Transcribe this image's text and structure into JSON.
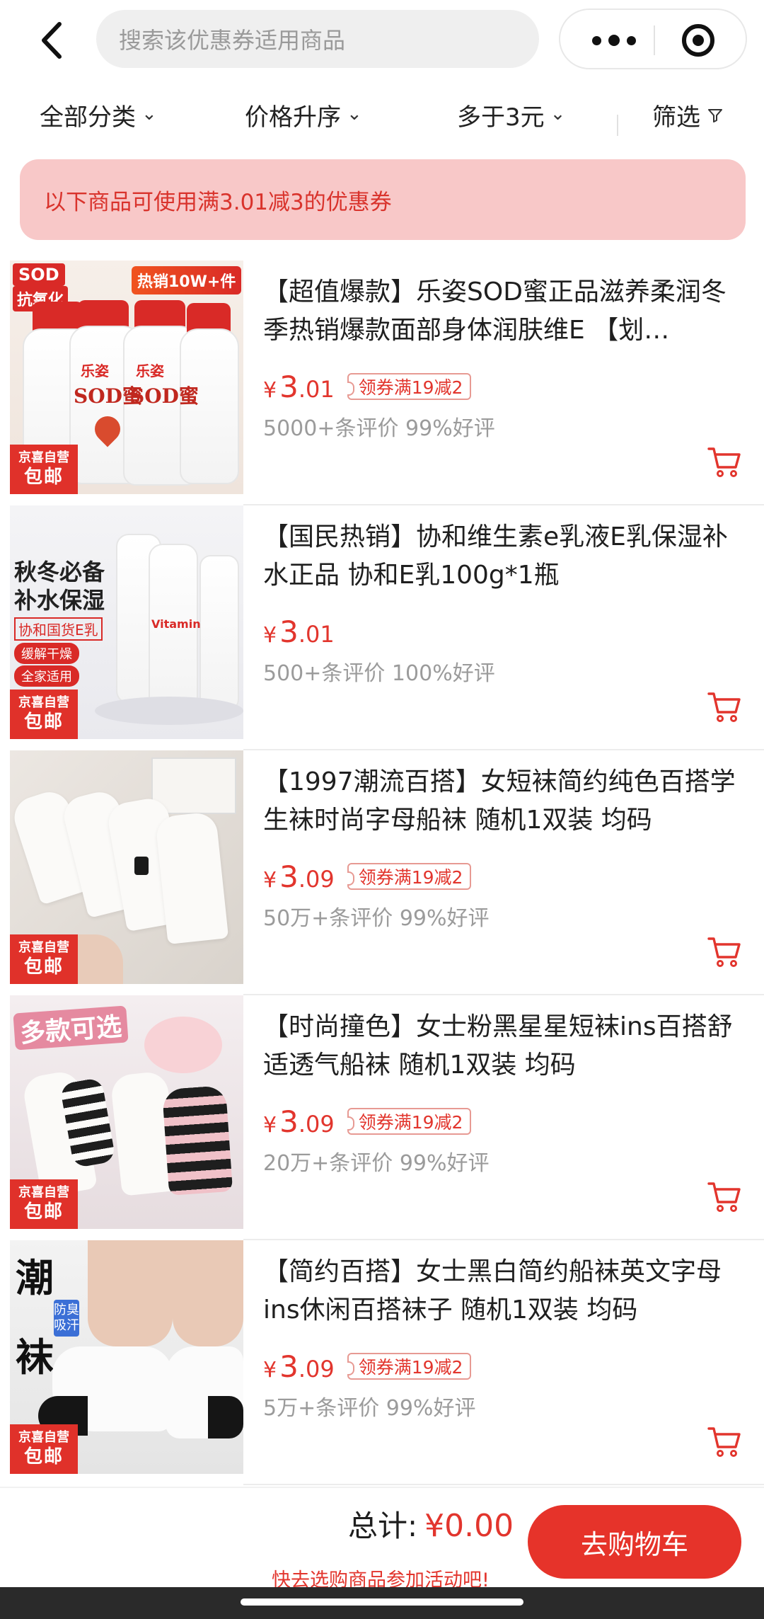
{
  "header": {
    "search_placeholder": "搜索该优惠券适用商品"
  },
  "filters": {
    "category": "全部分类",
    "sort": "价格升序",
    "min_price": "多于3元",
    "filter": "筛选"
  },
  "banner": "以下商品可使用满3.01减3的优惠券",
  "products": [
    {
      "title": "【超值爆款】乐姿SOD蜜正品滋养柔润冬季热销爆款面部身体润肤维E 【划…",
      "currency": "¥",
      "price_int": "3",
      "price_dec": ".01",
      "coupon": "领券满19减2",
      "reviews": "5000+条评价 99%好评",
      "thumb": {
        "tag1": "SOD",
        "tag2": "抗氧化",
        "tag3": "热销10W+件",
        "brand": "乐姿",
        "label": "SOD蜜",
        "jd": "京喜自营",
        "free": "包邮"
      }
    },
    {
      "title": "【国民热销】协和维生素e乳液E乳保湿补水正品 协和E乳100g*1瓶",
      "currency": "¥",
      "price_int": "3",
      "price_dec": ".01",
      "coupon": "",
      "reviews": "500+条评价 100%好评",
      "thumb": {
        "line1": "秋冬必备",
        "line2": "补水保湿",
        "line3": "协和国货E乳",
        "pill1": "缓解干燥",
        "pill2": "全家适用",
        "label": "Vitamin",
        "jd": "京喜自营",
        "free": "包邮"
      }
    },
    {
      "title": "【1997潮流百搭】女短袜简约纯色百搭学生袜时尚字母船袜 随机1双装 均码",
      "currency": "¥",
      "price_int": "3",
      "price_dec": ".09",
      "coupon": "领券满19减2",
      "reviews": "50万+条评价 99%好评",
      "thumb": {
        "jd": "京喜自营",
        "free": "包邮"
      }
    },
    {
      "title": "【时尚撞色】女士粉黑星星短袜ins百搭舒适透气船袜 随机1双装 均码",
      "currency": "¥",
      "price_int": "3",
      "price_dec": ".09",
      "coupon": "领券满19减2",
      "reviews": "20万+条评价 99%好评",
      "thumb": {
        "headline": "多款可选",
        "jd": "京喜自营",
        "free": "包邮"
      }
    },
    {
      "title": "【简约百搭】女士黑白简约船袜英文字母ins休闲百搭袜子 随机1双装 均码",
      "currency": "¥",
      "price_int": "3",
      "price_dec": ".09",
      "coupon": "领券满19减2",
      "reviews": "5万+条评价 99%好评",
      "thumb": {
        "big1": "潮",
        "big2": "袜",
        "tag": "防臭吸汗",
        "jd": "京喜自营",
        "free": "包邮"
      }
    }
  ],
  "bottom": {
    "total_label": "总计:",
    "total_amount": "¥0.00",
    "hint": "快去选购商品参加活动吧!",
    "checkout": "去购物车"
  },
  "colors": {
    "accent": "#e2352d",
    "banner_bg": "#f8c8c8"
  }
}
